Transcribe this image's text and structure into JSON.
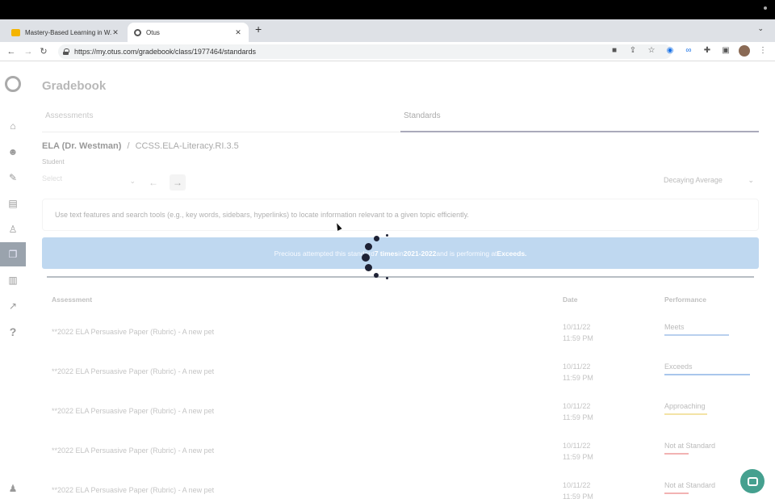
{
  "browser": {
    "tabs": [
      {
        "title": "Mastery-Based Learning in W...",
        "favicon_color": "#f4b400",
        "active": false
      },
      {
        "title": "Otus",
        "favicon_color": "#555555",
        "active": true
      }
    ],
    "url": "https://my.otus.com/gradebook/class/1977464/standards",
    "new_tab_label": "+",
    "tab_menu_label": "⌄"
  },
  "app": {
    "page_title": "Gradebook",
    "tabs": [
      {
        "label": "Assessments",
        "selected": false
      },
      {
        "label": "Standards",
        "selected": true
      }
    ],
    "breadcrumb": {
      "class_name": "ELA (Dr. Westman)",
      "separator": "/",
      "standard": "CCSS.ELA-Literacy.RI.3.5"
    },
    "student_label": "Student",
    "student_select_value": "Select",
    "average_select_value": "Decaying Average",
    "standard_description": "Use text features and search tools (e.g., key words, sidebars, hyperlinks) to locate information relevant to a given topic efficiently.",
    "banner": {
      "text_before": "Precious attempted this standard ",
      "times": "7 times",
      "text_mid": " in ",
      "year": "2021-2022",
      "text_after": " and is performing at ",
      "level": "Exceeds."
    },
    "table": {
      "headers": {
        "assessment": "Assessment",
        "date": "Date",
        "performance": "Performance"
      },
      "rows": [
        {
          "name": "**2022 ELA Persuasive Paper (Rubric) - A new pet",
          "date": "10/11/22",
          "time": "11:59 PM",
          "performance": "Meets",
          "bar_color": "#b9d0ee",
          "bar_fraction": 0.75
        },
        {
          "name": "**2022 ELA Persuasive Paper (Rubric) - A new pet",
          "date": "10/11/22",
          "time": "11:59 PM",
          "performance": "Exceeds",
          "bar_color": "#a9c6ec",
          "bar_fraction": 1.0
        },
        {
          "name": "**2022 ELA Persuasive Paper (Rubric) - A new pet",
          "date": "10/11/22",
          "time": "11:59 PM",
          "performance": "Approaching",
          "bar_color": "#f3e3a6",
          "bar_fraction": 0.5
        },
        {
          "name": "**2022 ELA Persuasive Paper (Rubric) - A new pet",
          "date": "10/11/22",
          "time": "11:59 PM",
          "performance": "Not at Standard",
          "bar_color": "#f2b3b3",
          "bar_fraction": 0.28
        },
        {
          "name": "**2022 ELA Persuasive Paper (Rubric) - A new pet",
          "date": "10/11/22",
          "time": "11:59 PM",
          "performance": "Not at Standard",
          "bar_color": "#f2b3b3",
          "bar_fraction": 0.28
        }
      ]
    }
  },
  "sidebar": {
    "items": [
      {
        "icon": "home-icon",
        "glyph": "⌂",
        "active": false
      },
      {
        "icon": "people-icon",
        "glyph": "☻",
        "active": false
      },
      {
        "icon": "chat-icon",
        "glyph": "✎",
        "active": false
      },
      {
        "icon": "book-icon",
        "glyph": "▤",
        "active": false
      },
      {
        "icon": "person-icon",
        "glyph": "♙",
        "active": false
      },
      {
        "icon": "bookmark-icon",
        "glyph": "❐",
        "active": true
      },
      {
        "icon": "map-icon",
        "glyph": "▥",
        "active": false
      },
      {
        "icon": "chart-icon",
        "glyph": "↗",
        "active": false
      },
      {
        "icon": "help-icon",
        "glyph": "?",
        "active": false
      }
    ],
    "bottom_icon": "user-icon"
  },
  "loading": true
}
